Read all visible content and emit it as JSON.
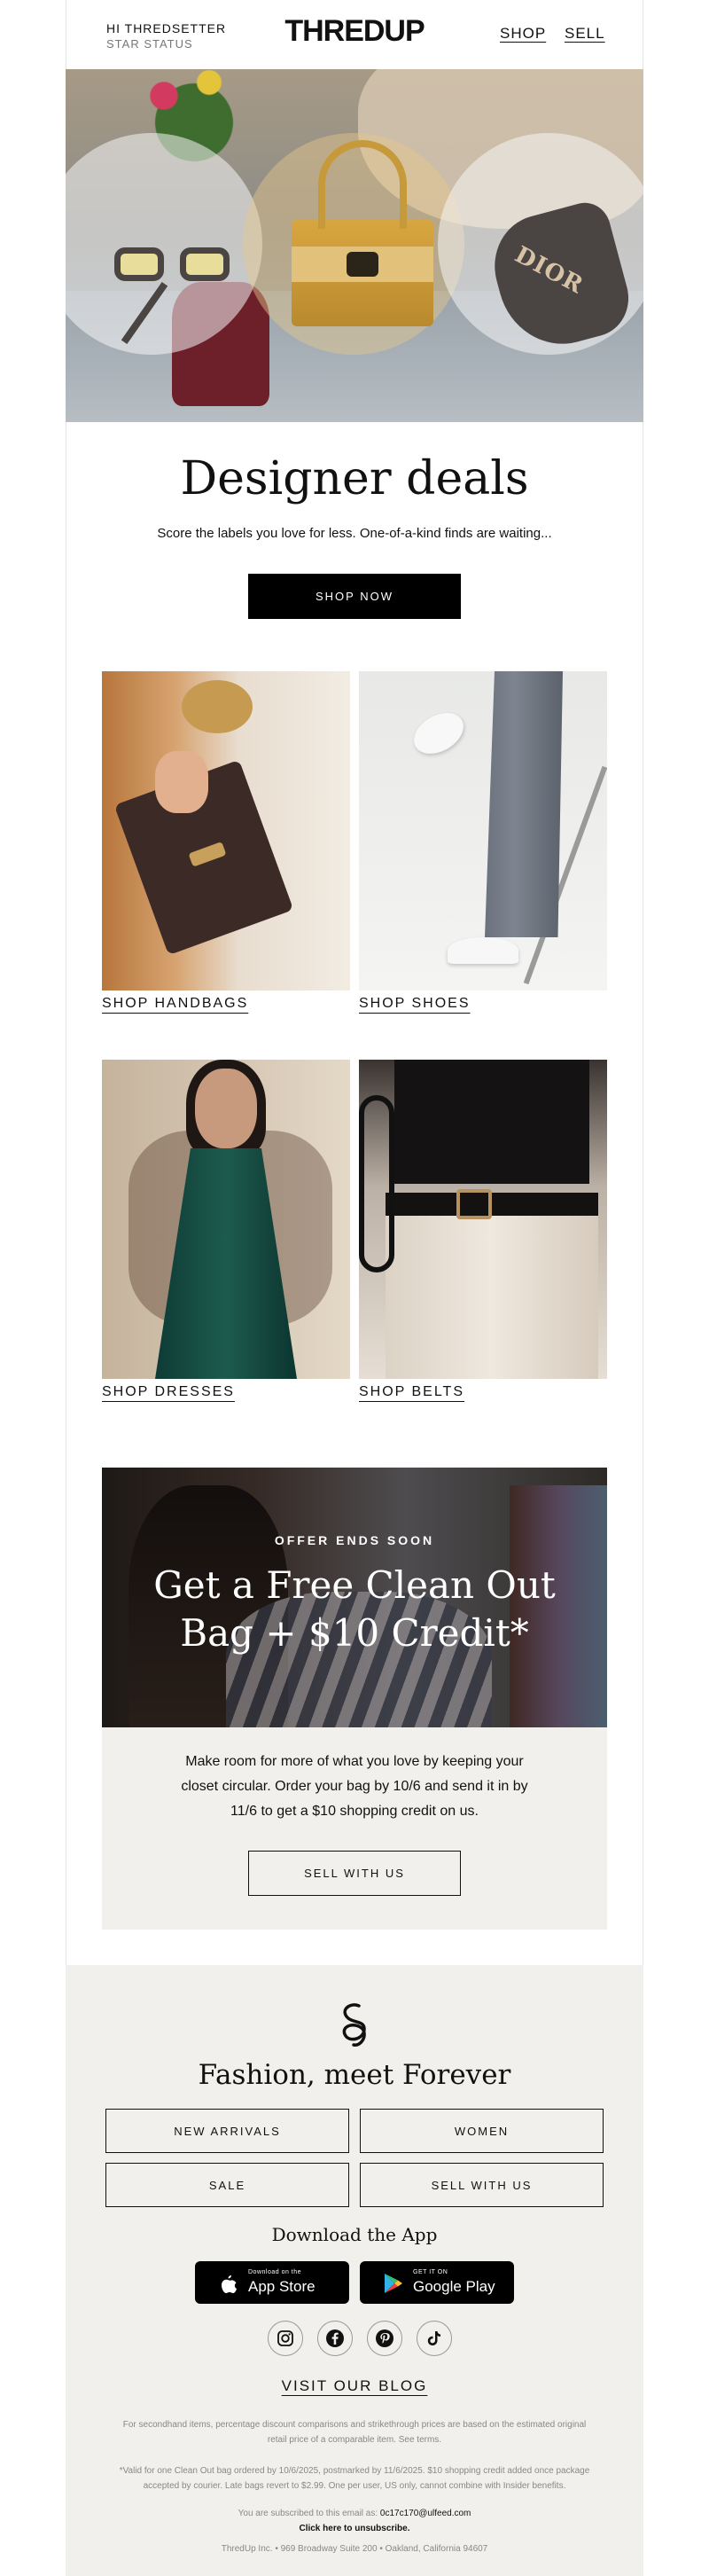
{
  "header": {
    "greeting": "HI THREDSETTER",
    "status": "STAR STATUS",
    "logo": "THREDUP",
    "nav": {
      "shop": "SHOP",
      "sell": "SELL"
    }
  },
  "hero": {
    "brand_mark": "DIOR"
  },
  "deals": {
    "title": "Designer deals",
    "subtitle": "Score the labels you love for less. One-of-a-kind finds are waiting...",
    "cta": "SHOP NOW"
  },
  "categories": [
    {
      "label": "SHOP HANDBAGS"
    },
    {
      "label": "SHOP SHOES"
    },
    {
      "label": "SHOP DRESSES"
    },
    {
      "label": "SHOP BELTS"
    }
  ],
  "offer": {
    "tag": "OFFER ENDS SOON",
    "title_line1": "Get a Free Clean Out",
    "title_line2": "Bag + $10 Credit*",
    "body": "Make room for more of what you love by keeping your closet circular. Order your bag by 10/6 and send it in by 11/6 to get a $10 shopping credit on us.",
    "cta": "SELL WITH US"
  },
  "footer": {
    "tagline": "Fashion, meet Forever",
    "links": [
      "NEW ARRIVALS",
      "WOMEN",
      "SALE",
      "SELL WITH US"
    ],
    "download_heading": "Download the App",
    "app_store": {
      "small": "Download on the",
      "big": "App Store"
    },
    "google_play": {
      "small": "GET IT ON",
      "big": "Google Play"
    },
    "social": [
      "instagram",
      "facebook",
      "pinterest",
      "tiktok"
    ],
    "blog": "VISIT OUR BLOG",
    "fine_print_1": "For secondhand items, percentage discount comparisons and strikethrough prices are based on the estimated original retail price of a comparable item. See terms.",
    "fine_print_2": "*Valid for one Clean Out bag ordered by 10/6/2025, postmarked by 11/6/2025. $10 shopping credit added once package accepted by courier. Late bags revert to $2.99. One per user, US only, cannot combine with Insider benefits.",
    "subscribed_prefix": "You are subscribed to this email as:",
    "subscribed_email": "0c17c170@ulfeed.com",
    "unsubscribe": "Click here to unsubscribe.",
    "address": "ThredUp Inc. • 969 Broadway Suite 200 • Oakland, California 94607"
  }
}
